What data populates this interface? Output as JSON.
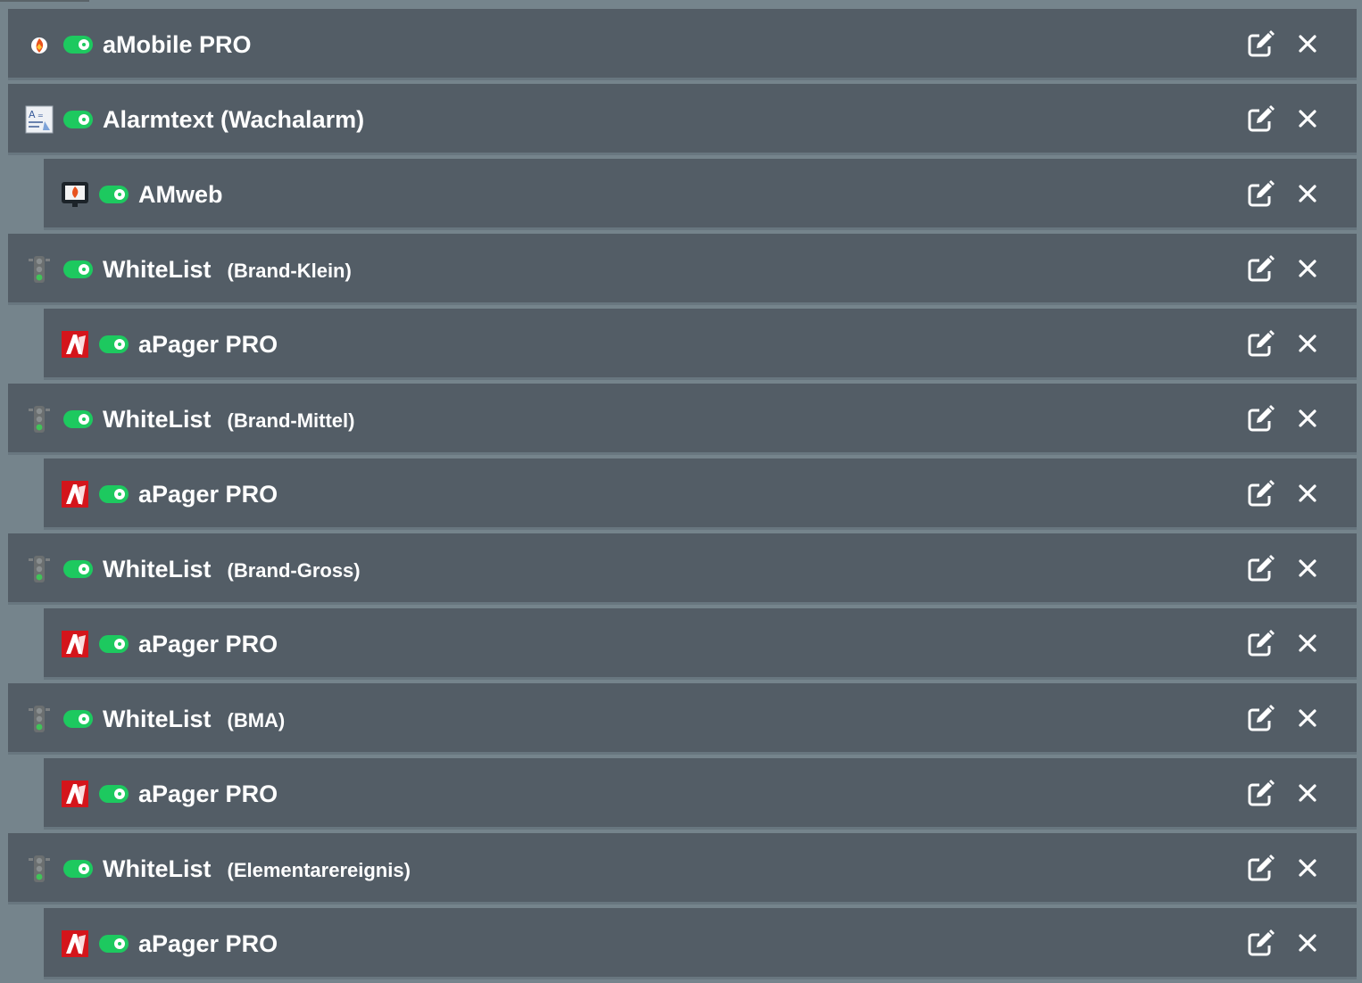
{
  "rows": [
    {
      "icon": "amobile-icon",
      "title": "aMobile PRO",
      "subtitle": "",
      "child": false
    },
    {
      "icon": "alarmtext-icon",
      "title": "Alarmtext (Wachalarm)",
      "subtitle": "",
      "child": false
    },
    {
      "icon": "amweb-icon",
      "title": "AMweb",
      "subtitle": "",
      "child": true
    },
    {
      "icon": "traffic-light-icon",
      "title": "WhiteList",
      "subtitle": "(Brand-Klein)",
      "child": false
    },
    {
      "icon": "apager-icon",
      "title": "aPager PRO",
      "subtitle": "",
      "child": true
    },
    {
      "icon": "traffic-light-icon",
      "title": "WhiteList",
      "subtitle": "(Brand-Mittel)",
      "child": false
    },
    {
      "icon": "apager-icon",
      "title": "aPager PRO",
      "subtitle": "",
      "child": true
    },
    {
      "icon": "traffic-light-icon",
      "title": "WhiteList",
      "subtitle": "(Brand-Gross)",
      "child": false
    },
    {
      "icon": "apager-icon",
      "title": "aPager PRO",
      "subtitle": "",
      "child": true
    },
    {
      "icon": "traffic-light-icon",
      "title": "WhiteList",
      "subtitle": "(BMA)",
      "child": false
    },
    {
      "icon": "apager-icon",
      "title": "aPager PRO",
      "subtitle": "",
      "child": true
    },
    {
      "icon": "traffic-light-icon",
      "title": "WhiteList",
      "subtitle": "(Elementarereignis)",
      "child": false
    },
    {
      "icon": "apager-icon",
      "title": "aPager PRO",
      "subtitle": "",
      "child": true
    }
  ],
  "colors": {
    "background": "#75848c",
    "row": "#535d66",
    "toggle_on": "#1dc95f",
    "text": "#ffffff",
    "apager_red": "#d4151b"
  }
}
